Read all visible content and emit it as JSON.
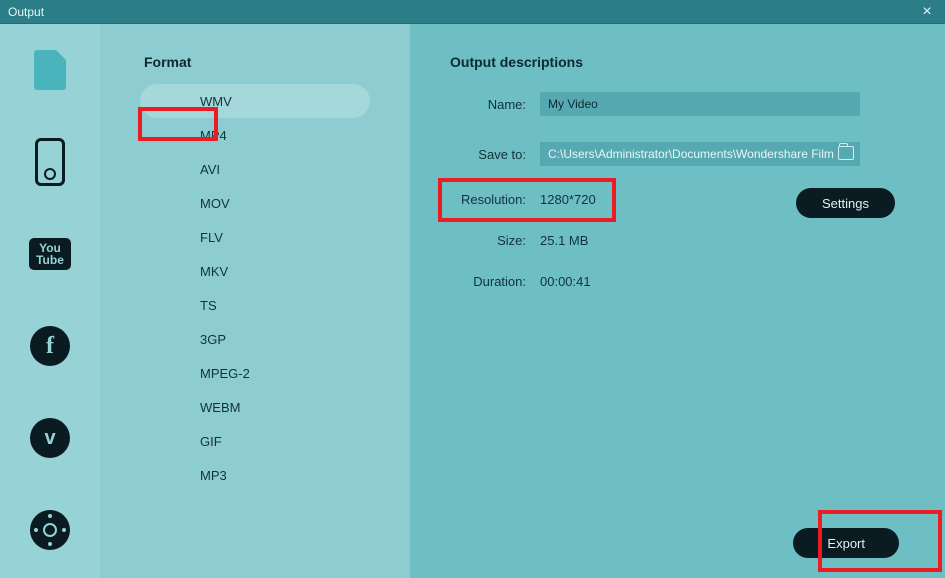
{
  "window": {
    "title": "Output"
  },
  "sidebar": {
    "youtube_label": "You\nTube"
  },
  "formats": {
    "heading": "Format",
    "items": [
      {
        "label": "WMV",
        "selected": true
      },
      {
        "label": "MP4",
        "selected": false
      },
      {
        "label": "AVI",
        "selected": false
      },
      {
        "label": "MOV",
        "selected": false
      },
      {
        "label": "FLV",
        "selected": false
      },
      {
        "label": "MKV",
        "selected": false
      },
      {
        "label": "TS",
        "selected": false
      },
      {
        "label": "3GP",
        "selected": false
      },
      {
        "label": "MPEG-2",
        "selected": false
      },
      {
        "label": "WEBM",
        "selected": false
      },
      {
        "label": "GIF",
        "selected": false
      },
      {
        "label": "MP3",
        "selected": false
      }
    ]
  },
  "details": {
    "heading": "Output descriptions",
    "name_label": "Name:",
    "name_value": "My Video",
    "saveto_label": "Save to:",
    "saveto_value": "C:\\Users\\Administrator\\Documents\\Wondershare Film",
    "resolution_label": "Resolution:",
    "resolution_value": "1280*720",
    "size_label": "Size:",
    "size_value": "25.1 MB",
    "duration_label": "Duration:",
    "duration_value": "00:00:41",
    "settings_button": "Settings",
    "export_button": "Export"
  }
}
